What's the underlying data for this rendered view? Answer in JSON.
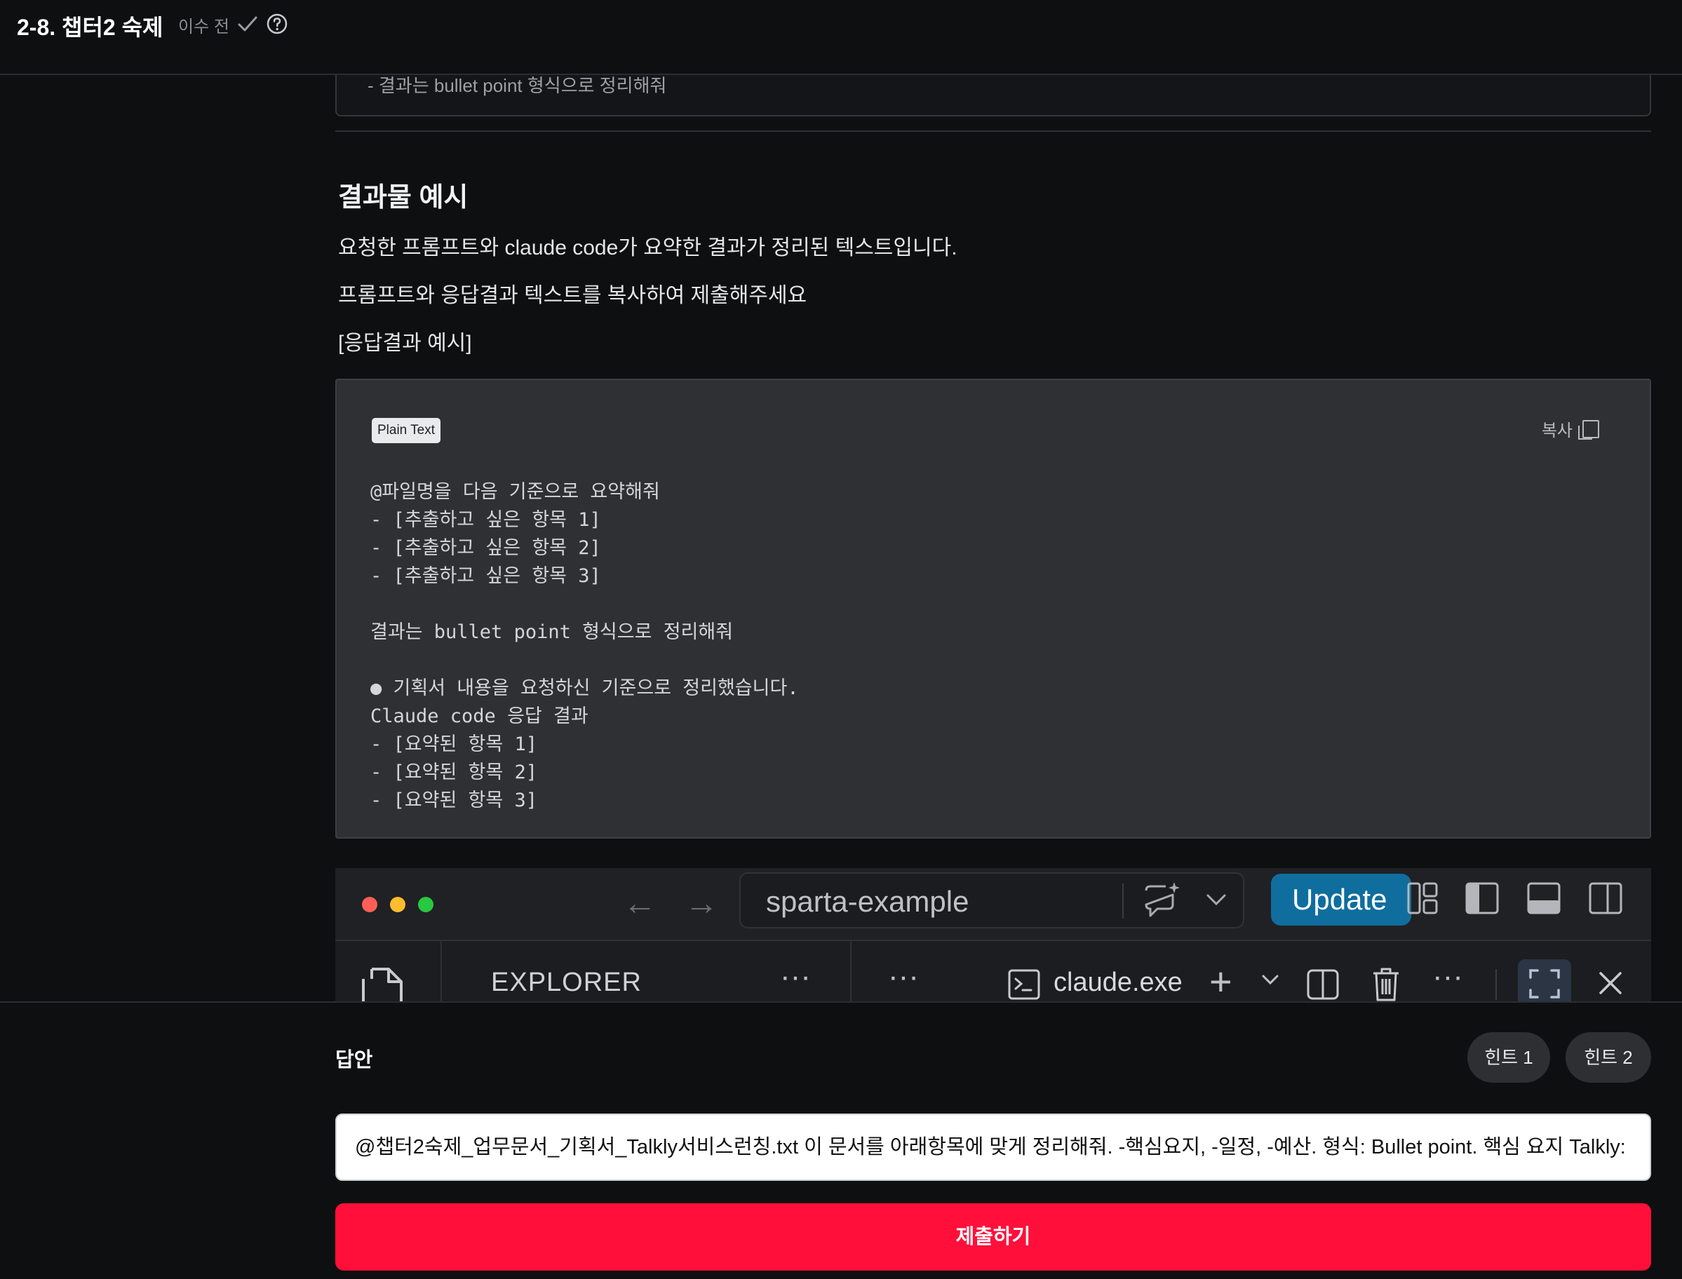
{
  "header": {
    "title": "2-8. 챕터2 숙제",
    "status": "이수 전"
  },
  "content": {
    "previous_box_text": "- 결과는 bullet point 형식으로 정리해줘",
    "section_heading": "결과물 예시",
    "paragraphs": [
      "요청한 프롬프트와 claude code가 요약한 결과가 정리된 텍스트입니다.",
      "프롬프트와 응답결과 텍스트를 복사하여 제출해주세요",
      "[응답결과 예시]"
    ],
    "code_block": {
      "language_badge": "Plain Text",
      "copy_label": "복사",
      "lines": [
        "@파일명을 다음 기준으로 요약해줘",
        "- [추출하고 싶은 항목 1]",
        "- [추출하고 싶은 항목 2]",
        "- [추출하고 싶은 항목 3]",
        "",
        "결과는 bullet point 형식으로 정리해줘",
        "",
        "● 기획서 내용을 요청하신 기준으로 정리했습니다.",
        "Claude code 응답 결과",
        "- [요약된 항목 1]",
        "- [요약된 항목 2]",
        "- [요약된 항목 3]"
      ]
    },
    "ide_screenshot": {
      "search_text": "sparta-example",
      "update_label": "Update",
      "explorer_label": "EXPLORER",
      "more_label": "···",
      "terminal_label": "claude.exe"
    }
  },
  "answer": {
    "label": "답안",
    "hint1_label": "힌트 1",
    "hint2_label": "힌트 2",
    "input_value": "@챕터2숙제_업무문서_기획서_Talkly서비스런칭.txt  이 문서를 아래항목에 맞게 정리해줘. -핵심요지, -일정, -예산. 형식: Bullet point. 핵심 요지  Talkly:",
    "submit_label": "제출하기"
  },
  "colors": {
    "background": "#0e0f11",
    "code_background": "#2e3034",
    "submit_red": "#ff0f3a",
    "update_blue": "#0f6e9e"
  },
  "icons": [
    "check-icon",
    "help-icon",
    "copy-icon",
    "back-arrow-icon",
    "forward-arrow-icon",
    "chat-sparkle-icon",
    "chevron-down-icon",
    "layout-grid-icon",
    "panel-left-icon",
    "panel-bottom-icon",
    "panel-right-icon",
    "files-icon",
    "terminal-icon",
    "plus-icon",
    "split-icon",
    "trash-icon",
    "maximize-icon",
    "close-icon"
  ]
}
